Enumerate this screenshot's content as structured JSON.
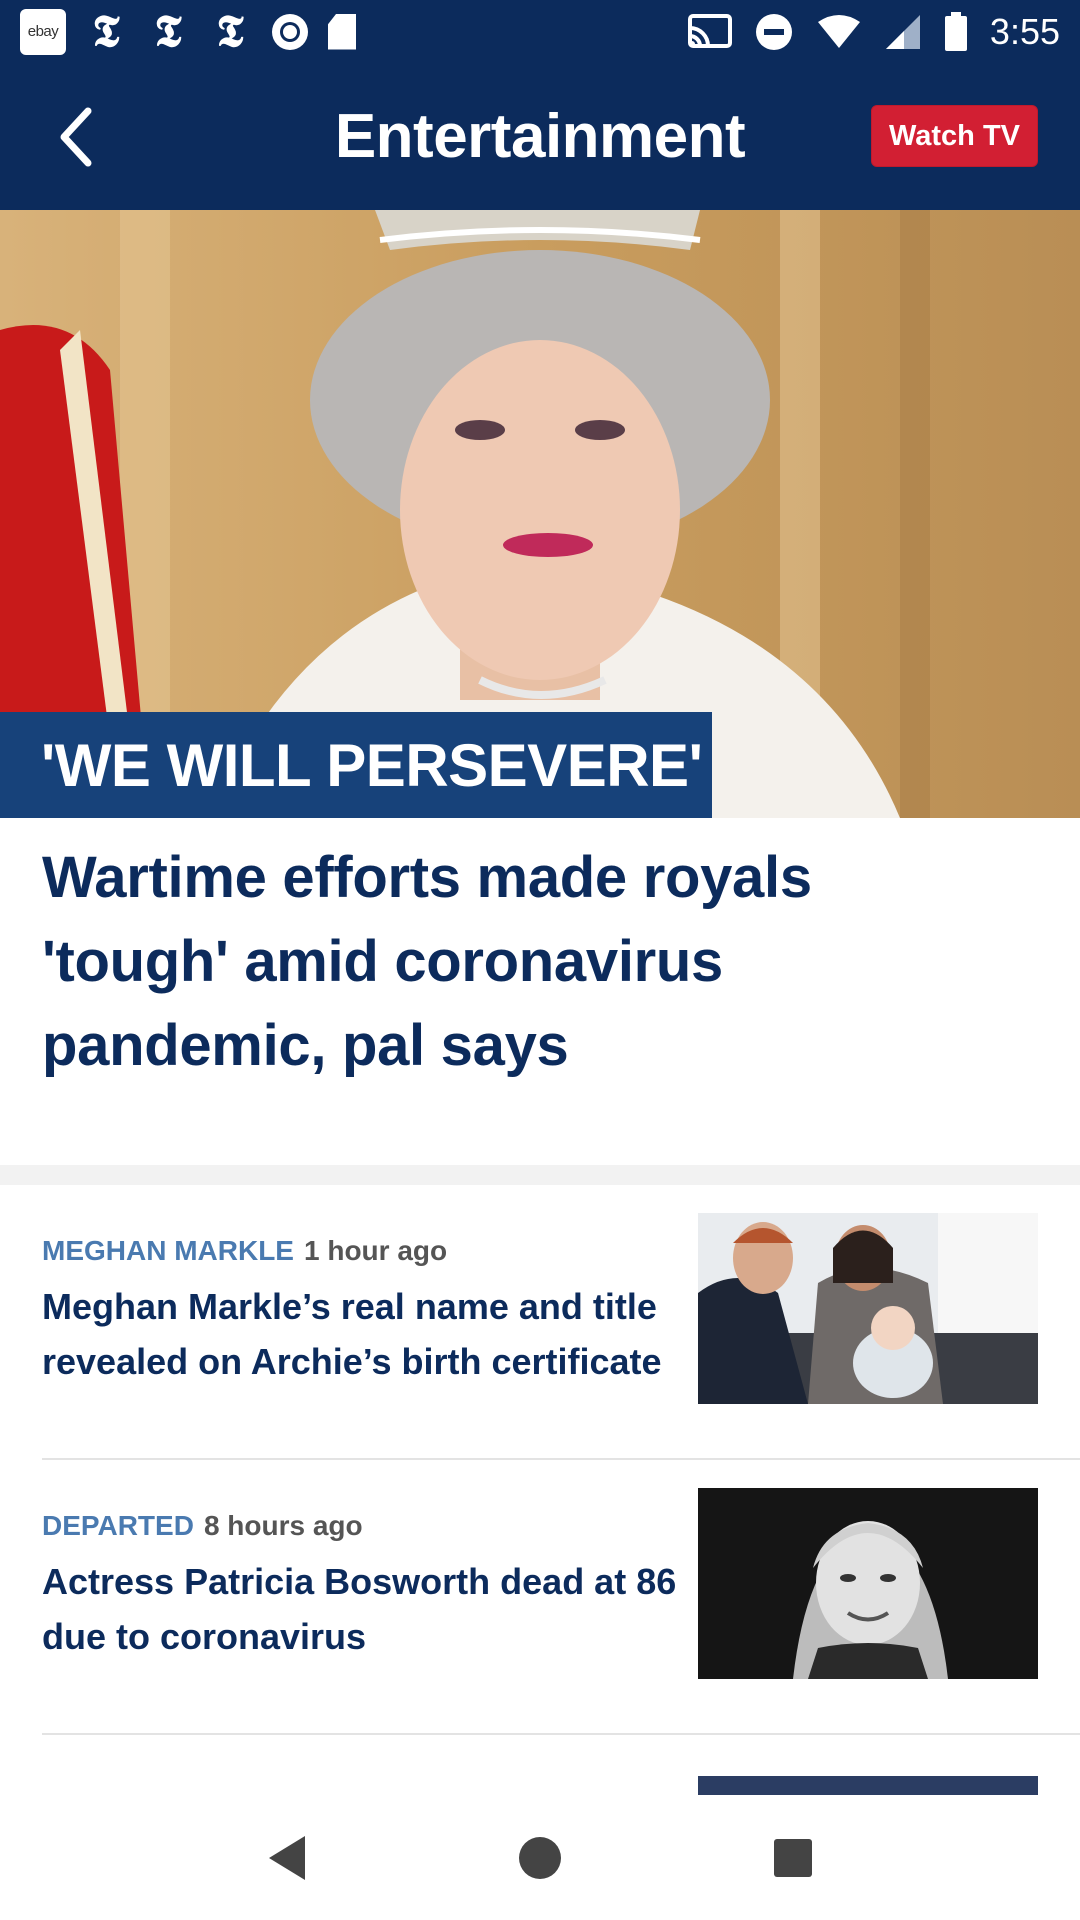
{
  "status_bar": {
    "time": "3:55",
    "left_icons": [
      "ebay-icon",
      "nyt-icon",
      "nyt-icon",
      "nyt-icon",
      "record-icon",
      "sd-card-icon"
    ],
    "right_icons": [
      "cast-icon",
      "do-not-disturb-icon",
      "wifi-icon",
      "signal-icon",
      "battery-icon"
    ],
    "ebay_label": "ebay",
    "nyt_glyph": "𝕿"
  },
  "app_bar": {
    "title": "Entertainment",
    "watch_tv_label": "Watch TV",
    "colors": {
      "background": "#0c2b5c",
      "watch_tv": "#d21f33"
    }
  },
  "hero": {
    "banner_text": "'WE WILL PERSEVERE'",
    "headline": "Wartime efforts made royals 'tough' amid coronavirus pandemic, pal says"
  },
  "articles": [
    {
      "category": "MEGHAN MARKLE",
      "time": "1 hour ago",
      "title": "Meghan Markle’s real name and title revealed on Archie’s birth certificate"
    },
    {
      "category": "DEPARTED",
      "time": "8 hours ago",
      "title": "Actress Patricia Bosworth dead at 86 due to coronavirus"
    }
  ],
  "nav_bar": {
    "buttons": [
      "back-triangle-icon",
      "home-circle-icon",
      "recents-square-icon"
    ]
  }
}
